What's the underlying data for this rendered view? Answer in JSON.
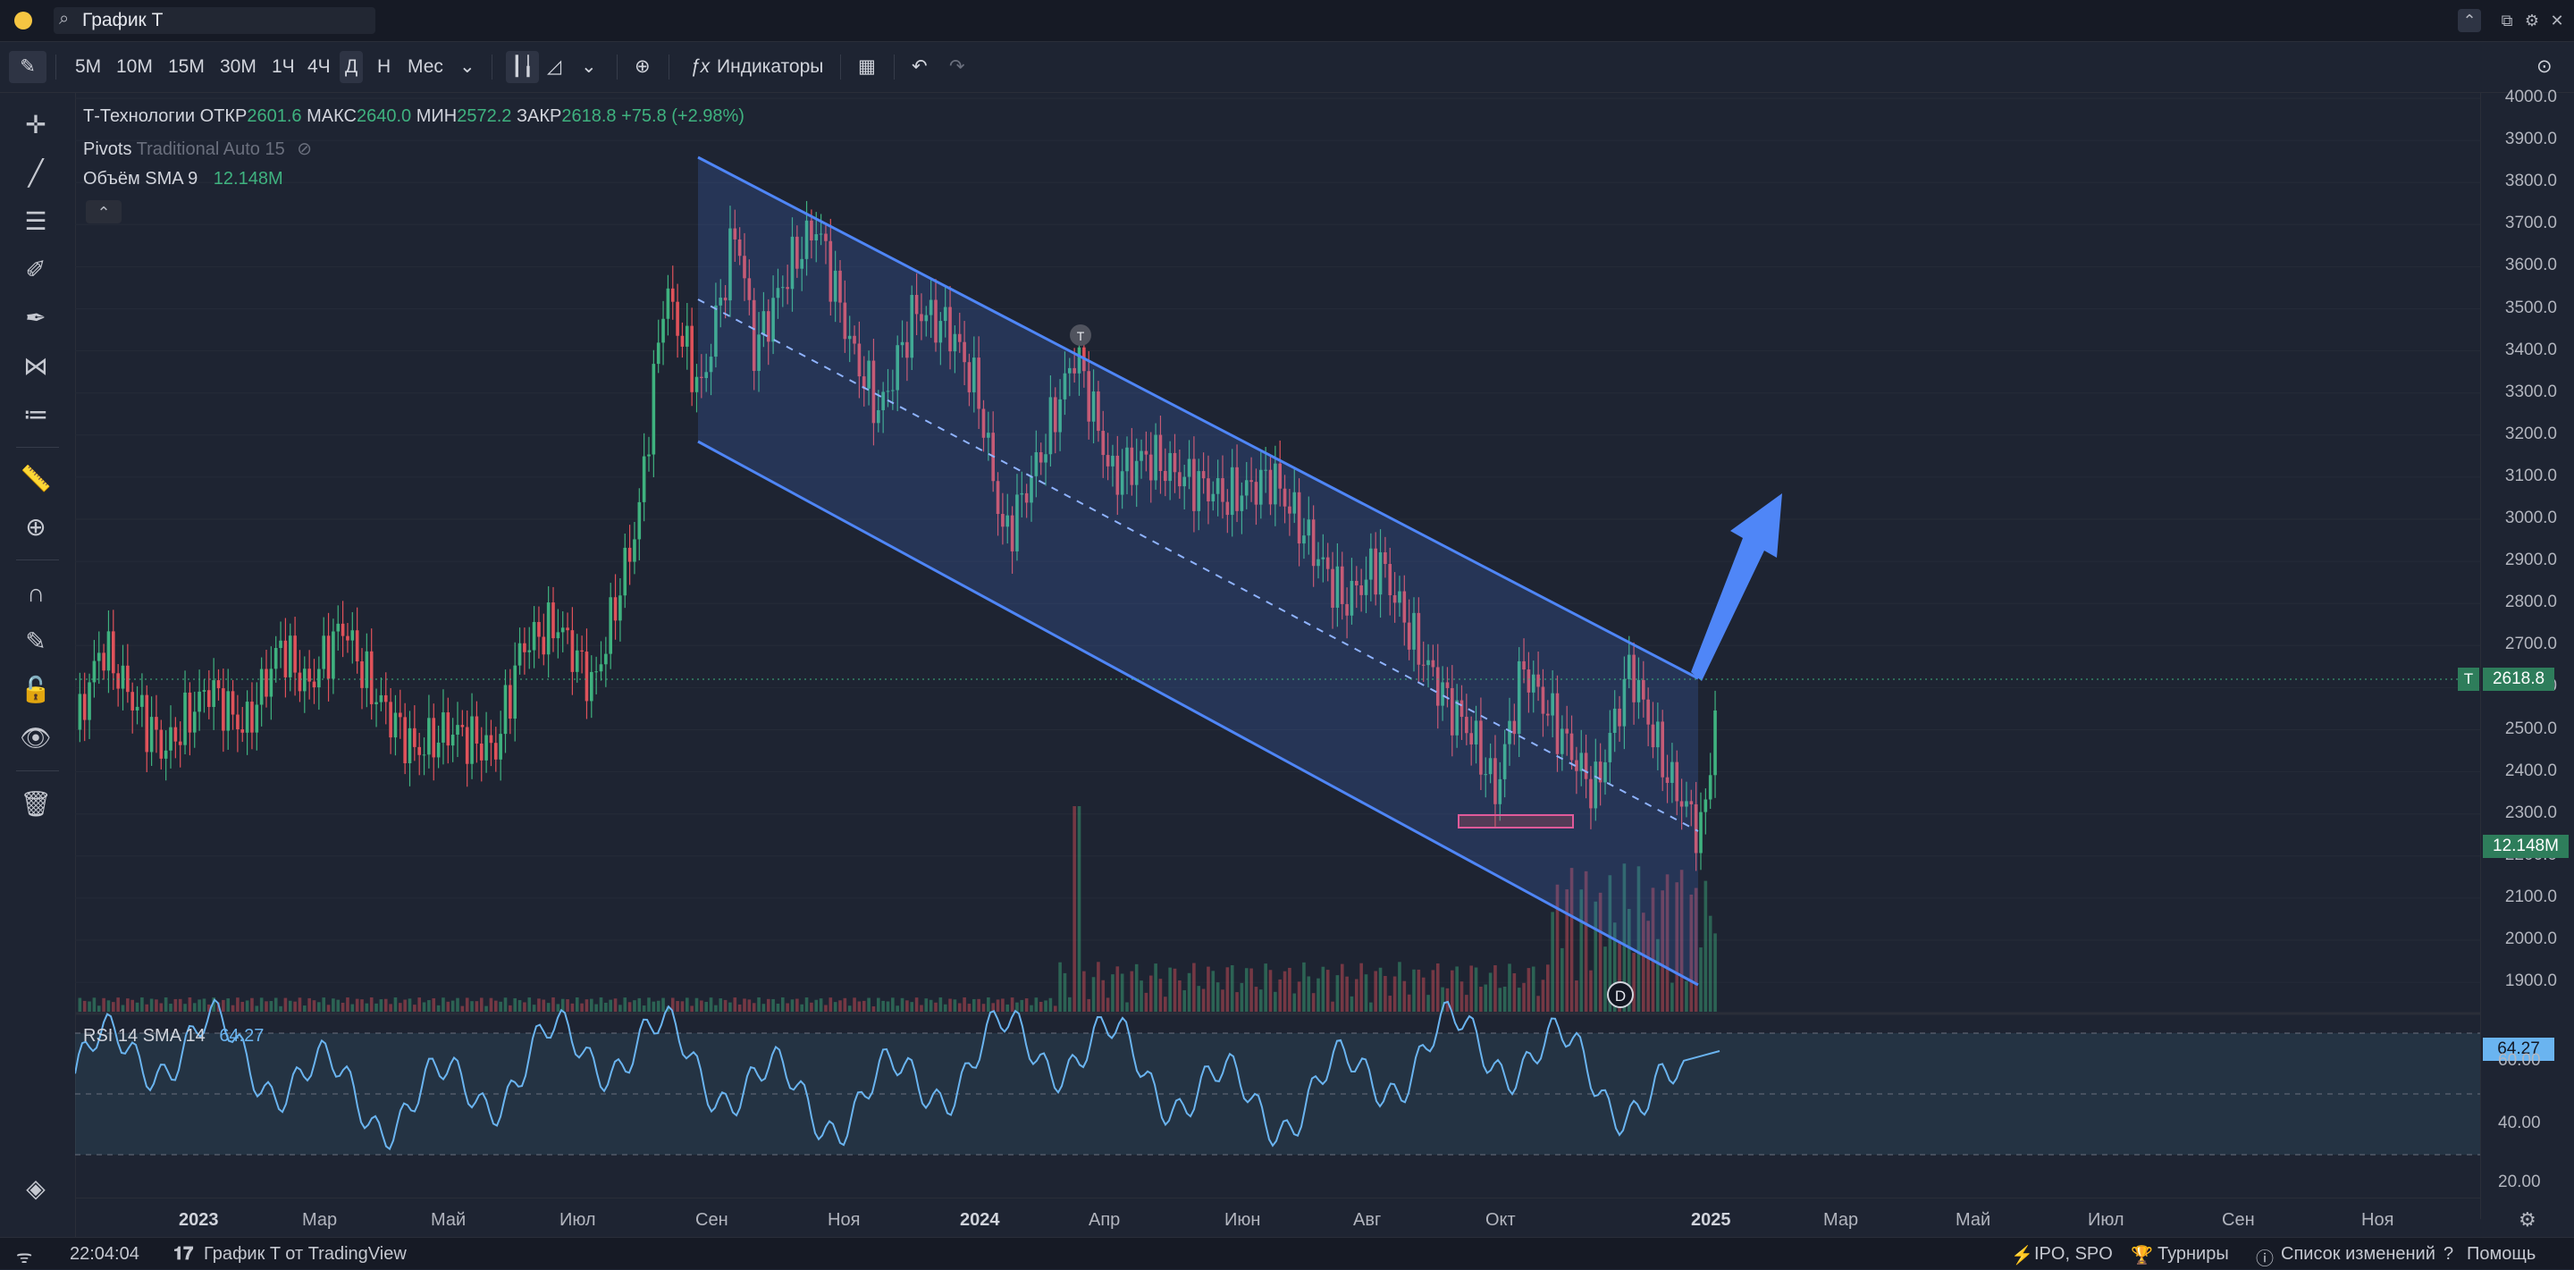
{
  "window": {
    "title": "График T"
  },
  "toolbar": {
    "intervals": [
      "5М",
      "10М",
      "15М",
      "30М",
      "1Ч",
      "4Ч",
      "Д",
      "Н",
      "Мес"
    ],
    "selected_interval": "Д",
    "indicators_label": "Индикаторы",
    "icons": [
      "pencil-icon",
      "candles-icon",
      "area-chart-icon",
      "chevron-down-icon",
      "add-icon",
      "fx-icon",
      "layout-icon",
      "undo-icon",
      "redo-icon",
      "camera-icon"
    ]
  },
  "legend": {
    "symbol": "Т-Технологии",
    "open_label": "ОТКР",
    "open": "2601.6",
    "high_label": "МАКС",
    "high": "2640.0",
    "low_label": "МИН",
    "low": "2572.2",
    "close_label": "ЗАКР",
    "close": "2618.8",
    "change": "+75.8 (+2.98%)",
    "pivots_label": "Pivots",
    "pivots_params": "Traditional Auto 15",
    "volume_label": "Объём SMA 9",
    "volume_value": "12.148M"
  },
  "rsi": {
    "label": "RSI 14 SMA 14",
    "value": "64.27",
    "levels": [
      "60.00",
      "40.00",
      "20.00"
    ]
  },
  "price_axis": {
    "labels": [
      "4000.0",
      "3900.0",
      "3800.0",
      "3700.0",
      "3600.0",
      "3500.0",
      "3400.0",
      "3300.0",
      "3200.0",
      "3100.0",
      "3000.0",
      "2900.0",
      "2800.0",
      "2700.0",
      "2600.0",
      "2500.0",
      "2400.0",
      "2300.0",
      "2200.0",
      "2100.0",
      "2000.0",
      "1900.0"
    ],
    "current_price": "2618.8",
    "current_symbol": "T",
    "volume_badge": "12.148M"
  },
  "time_axis": {
    "labels": [
      "2023",
      "Мар",
      "Май",
      "Июл",
      "Сен",
      "Ноя",
      "2024",
      "Апр",
      "Июн",
      "Авг",
      "Окт",
      "2025",
      "Мар",
      "Май",
      "Июл",
      "Сен",
      "Ноя"
    ],
    "bold": [
      "2023",
      "2024",
      "2025"
    ]
  },
  "markers": {
    "t": "T",
    "d": "D"
  },
  "status": {
    "time": "22:04:04",
    "chart_label": "График T от TradingView",
    "ipo": "IPO, SPO",
    "tournaments": "Турниры",
    "changelog": "Список изменений",
    "help": "Помощь"
  },
  "colors": {
    "bg": "#1e2432",
    "up": "#3fb27f",
    "down": "#e0525a",
    "channel": "#4f86f7",
    "rsi": "#6ab4f0",
    "arrow": "#4f86f7"
  }
}
